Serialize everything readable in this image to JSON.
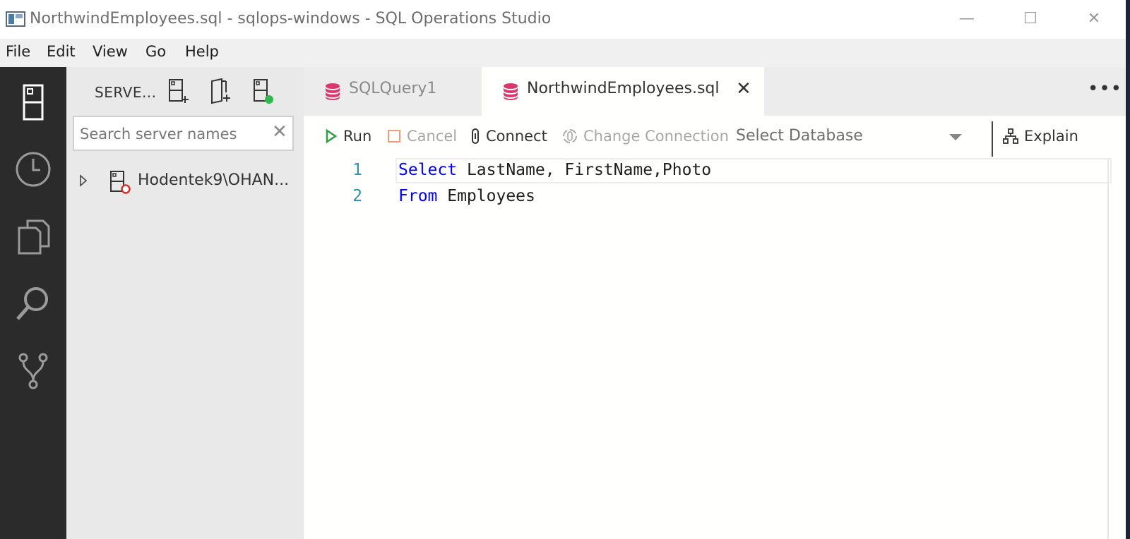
{
  "window": {
    "title": "NorthwindEmployees.sql - sqlops-windows - SQL Operations Studio",
    "minimize_glyph": "—",
    "maximize_glyph": "☐",
    "close_glyph": "✕"
  },
  "menu": {
    "items": [
      {
        "label": "File"
      },
      {
        "label": "Edit"
      },
      {
        "label": "View"
      },
      {
        "label": "Go"
      },
      {
        "label": "Help"
      }
    ]
  },
  "activity_bar": {
    "icons": [
      "servers-icon",
      "history-icon",
      "explorer-icon",
      "search-icon",
      "source-control-icon"
    ]
  },
  "sidebar": {
    "title": "SERVE...",
    "search": {
      "placeholder": "Search server names",
      "value": "",
      "clear_glyph": "✕"
    },
    "tree": [
      {
        "label": "Hodentek9\\OHAN...",
        "status_color": "#d0342c"
      }
    ]
  },
  "tabs": [
    {
      "label": "SQLQuery1",
      "active": false
    },
    {
      "label": "NorthwindEmployees.sql",
      "active": true,
      "close_glyph": "✕"
    }
  ],
  "tab_more_glyph": "•••",
  "toolbar": {
    "run_label": "Run",
    "cancel_label": "Cancel",
    "connect_label": "Connect",
    "change_connection_label": "Change Connection",
    "database_select_label": "Select Database",
    "explain_label": "Explain"
  },
  "editor": {
    "lines": [
      {
        "number": "1",
        "keyword": "Select",
        "rest": " LastName, FirstName,Photo"
      },
      {
        "number": "2",
        "keyword": "From",
        "rest": " Employees"
      }
    ]
  },
  "colors": {
    "activity_bar": "#2b2b2b",
    "sidebar": "#e9e9e9",
    "keyword": "#0000ff",
    "line_number": "#2b91af",
    "db_icon": "#d9386e",
    "run_icon": "#2ea043",
    "cancel_icon": "#e8a07a",
    "server_online": "#2fb84b"
  }
}
